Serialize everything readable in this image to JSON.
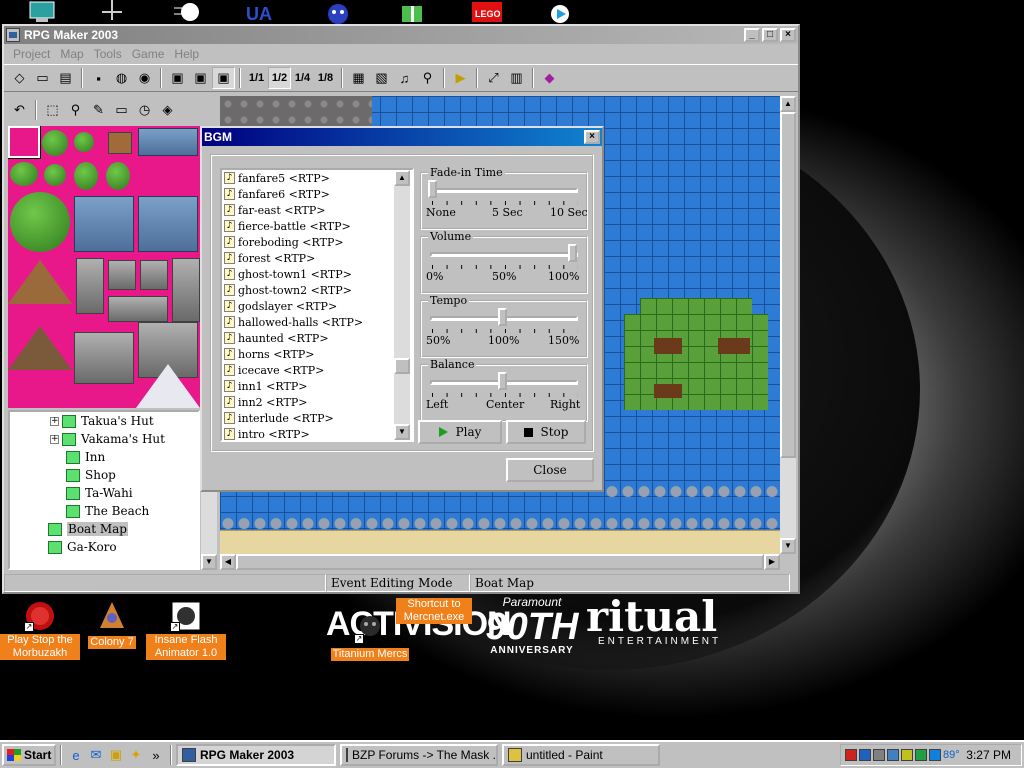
{
  "main_window": {
    "title": "RPG Maker 2003",
    "menu": [
      "Project",
      "Map",
      "Tools",
      "Game",
      "Help"
    ],
    "toolbar_fractions": [
      "1/1",
      "1/2",
      "1/4",
      "1/8"
    ]
  },
  "map_tree": {
    "items": [
      {
        "label": "Takua's Hut",
        "expandable": true,
        "selected": false
      },
      {
        "label": "Vakama's Hut",
        "expandable": true,
        "selected": false
      },
      {
        "label": "Inn",
        "expandable": false,
        "selected": false
      },
      {
        "label": "Shop",
        "expandable": false,
        "selected": false
      },
      {
        "label": "Ta-Wahi",
        "expandable": false,
        "selected": false
      },
      {
        "label": "The Beach",
        "expandable": false,
        "selected": false
      },
      {
        "label": "Boat Map",
        "expandable": false,
        "selected": true
      },
      {
        "label": "Ga-Koro",
        "expandable": false,
        "selected": false
      }
    ]
  },
  "status_bar": {
    "mode": "Event Editing Mode",
    "map": "Boat Map"
  },
  "bgm_dialog": {
    "title": "BGM",
    "songs": [
      "fanfare5 <RTP>",
      "fanfare6 <RTP>",
      "far-east <RTP>",
      "fierce-battle <RTP>",
      "foreboding <RTP>",
      "forest <RTP>",
      "ghost-town1 <RTP>",
      "ghost-town2 <RTP>",
      "godslayer <RTP>",
      "hallowed-halls <RTP>",
      "haunted <RTP>",
      "horns <RTP>",
      "icecave <RTP>",
      "inn1 <RTP>",
      "inn2 <RTP>",
      "interlude <RTP>",
      "intro <RTP>"
    ],
    "fade_in": {
      "label": "Fade-in Time",
      "scale": [
        "None",
        "5 Sec",
        "10 Sec"
      ],
      "level": 0
    },
    "volume": {
      "label": "Volume",
      "scale": [
        "0%",
        "50%",
        "100%"
      ],
      "level": 1.0
    },
    "tempo": {
      "label": "Tempo",
      "scale": [
        "50%",
        "100%",
        "150%"
      ],
      "level": 0.5
    },
    "balance": {
      "label": "Balance",
      "scale": [
        "Left",
        "Center",
        "Right"
      ],
      "level": 0.5
    },
    "play_label": "Play",
    "stop_label": "Stop",
    "close_label": "Close"
  },
  "desktop_icons": [
    {
      "label": "Play Stop the Morbuzakh"
    },
    {
      "label": "Colony 7"
    },
    {
      "label": "Insane Flash Animator 1.0"
    },
    {
      "label": "Shortcut to Mercnet.exe"
    },
    {
      "label": "Titanium Mercs"
    }
  ],
  "wallpaper": {
    "brand_left": "ACTIVISION",
    "brand_mid_top": "Paramount",
    "brand_mid": "90TH",
    "brand_mid_sub": "ANNIVERSARY",
    "brand_right": "ritual",
    "brand_right_sub": "ENTERTAINMENT"
  },
  "taskbar": {
    "start_label": "Start",
    "tasks": [
      {
        "label": "RPG Maker 2003",
        "active": true
      },
      {
        "label": "BZP Forums -> The Mask ...",
        "active": false
      },
      {
        "label": "untitled - Paint",
        "active": false
      }
    ],
    "clock": "3:27 PM",
    "temp": "89°"
  },
  "colors": {
    "titlebar_active": "#000080",
    "titlebar_inactive": "#808080",
    "desktop_label_bg": "#f0801a",
    "palette_bg": "#e8188a",
    "water": "#2d7bd4",
    "grass": "#5aa03a"
  }
}
